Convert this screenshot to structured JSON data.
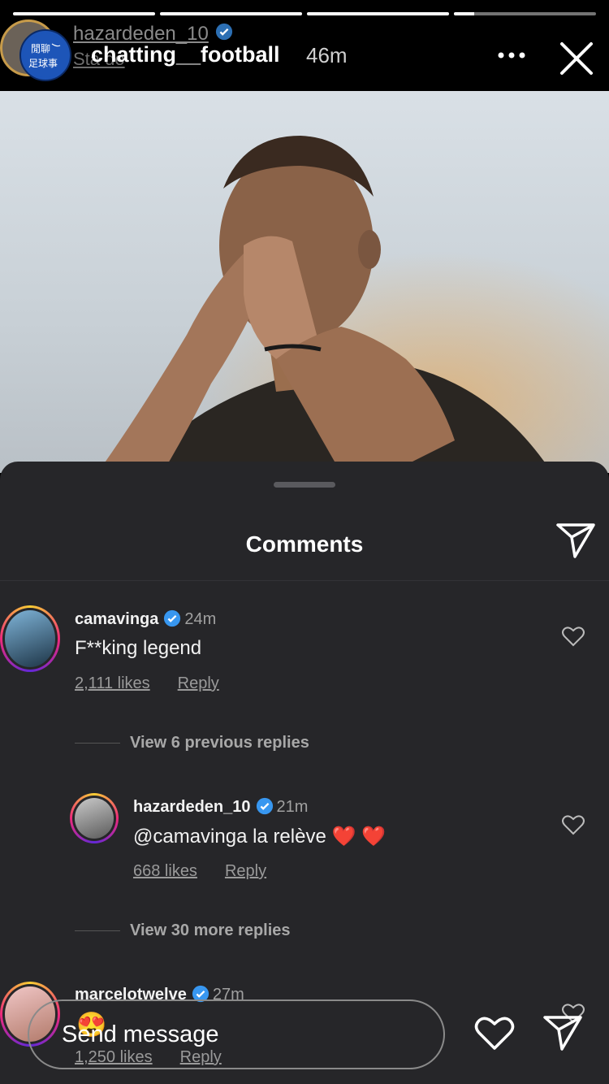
{
  "story": {
    "progress": [
      1,
      1,
      1,
      0.14
    ],
    "ghost_username": "hazardeden_10",
    "ghost_sub": "Sta      do",
    "username": "chatting__football",
    "time": "46m",
    "avatar_badge_text_1": "閒聊",
    "avatar_badge_text_2": "足球事"
  },
  "comments_sheet": {
    "title": "Comments",
    "comments": [
      {
        "username": "camavinga",
        "time": "24m",
        "text": "F**king legend",
        "likes": "2,111 likes",
        "reply": "Reply"
      },
      {
        "view_replies": "View 6 previous replies"
      },
      {
        "username": "hazardeden_10",
        "time": "21m",
        "text": "@camavinga la relève ❤️ ❤️",
        "likes": "668 likes",
        "reply": "Reply"
      },
      {
        "view_replies": "View 30 more replies"
      },
      {
        "username": "marcelotwelve",
        "time": "27m",
        "text": "😍",
        "likes": "1,250 likes",
        "reply": "Reply"
      }
    ]
  },
  "footer": {
    "message_placeholder": "Send message"
  },
  "colors": {
    "sheet_bg": "#262629",
    "verified": "#3897f0",
    "accent_ring": "#ee2a7b"
  },
  "icons": [
    "more-icon",
    "close-icon",
    "share-icon",
    "heart-icon",
    "send-icon",
    "verified-icon"
  ]
}
